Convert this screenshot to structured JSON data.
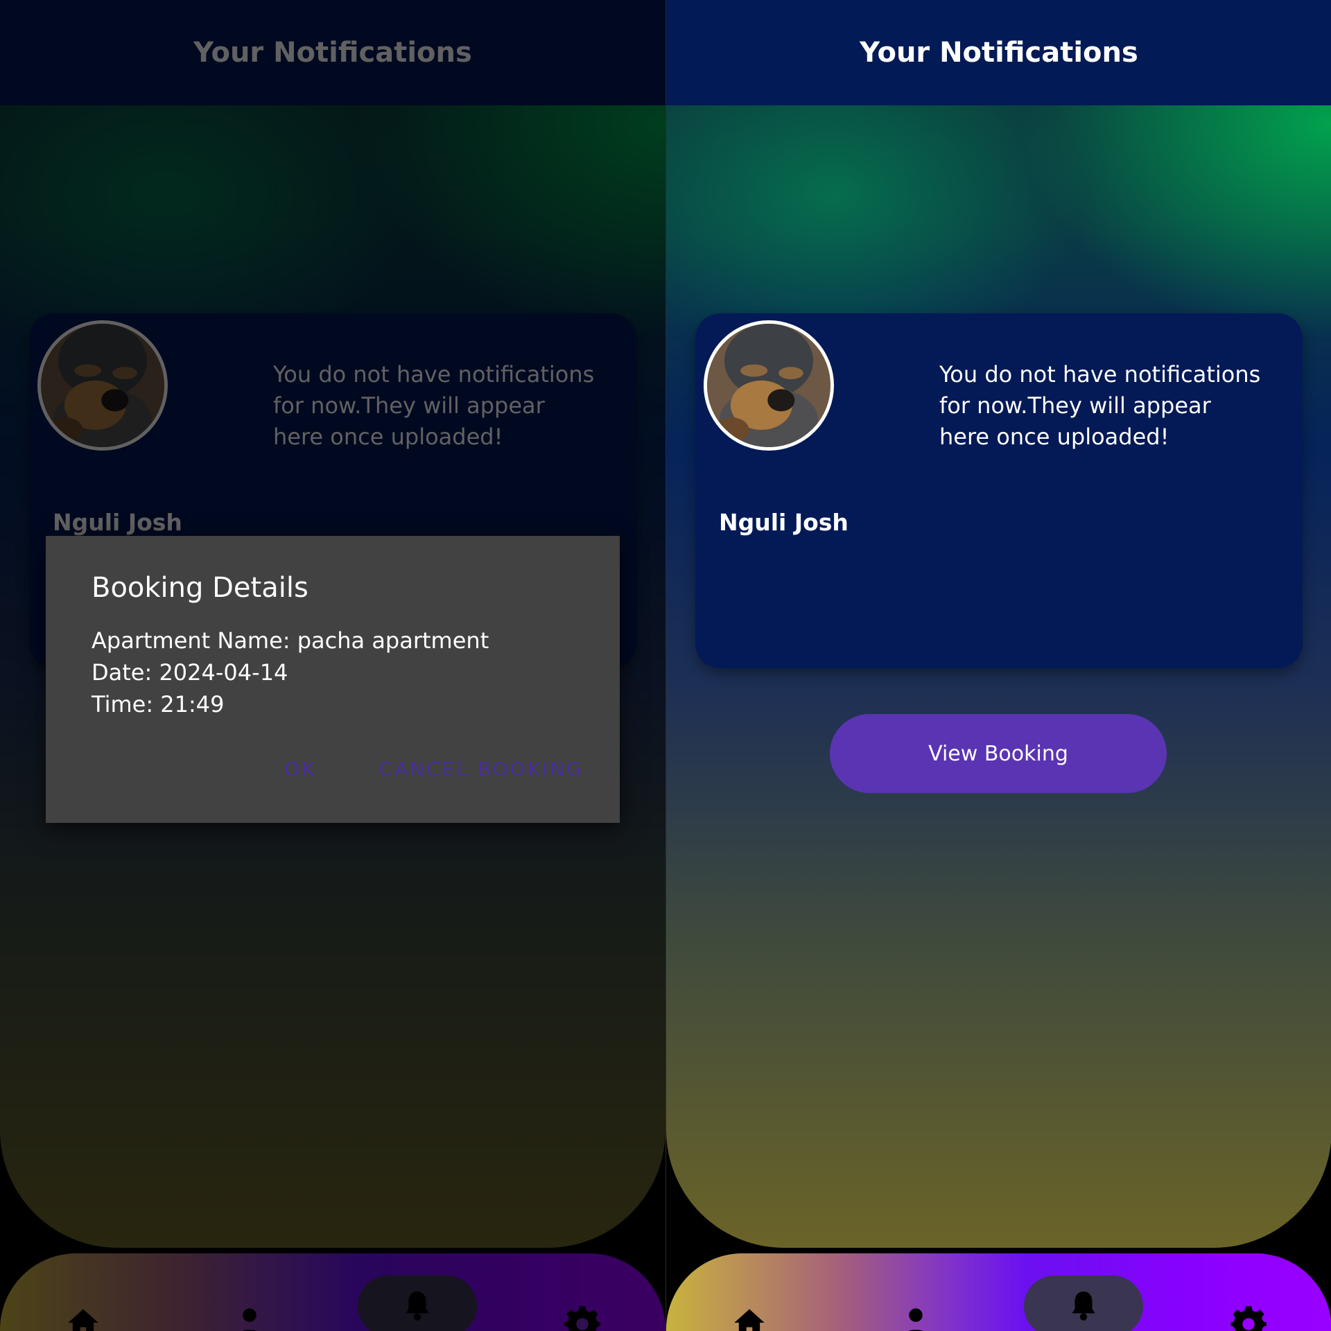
{
  "screen": {
    "title": "Your Notifications",
    "card": {
      "message": "You do not have notifications for now.They will appear here once uploaded!",
      "user_name": "Nguli Josh"
    },
    "view_booking_label": "View Booking"
  },
  "nav": {
    "items": [
      "home-icon",
      "profile-icon",
      "bell-icon",
      "settings-icon"
    ],
    "active": "bell-icon"
  },
  "dialog": {
    "title": "Booking Details",
    "apartment_line": "Apartment Name: pacha apartment",
    "date_line": "Date: 2024-04-14",
    "time_line": "Time: 21:49",
    "ok_label": "OK",
    "cancel_label": "CANCEL BOOKING"
  },
  "colors": {
    "header": "#021a55",
    "card": "#031a56",
    "button": "#5a34b2",
    "dialog": "#424242",
    "dialog_button_text": "#4a2ea0",
    "nav_active": "#3a3550"
  }
}
